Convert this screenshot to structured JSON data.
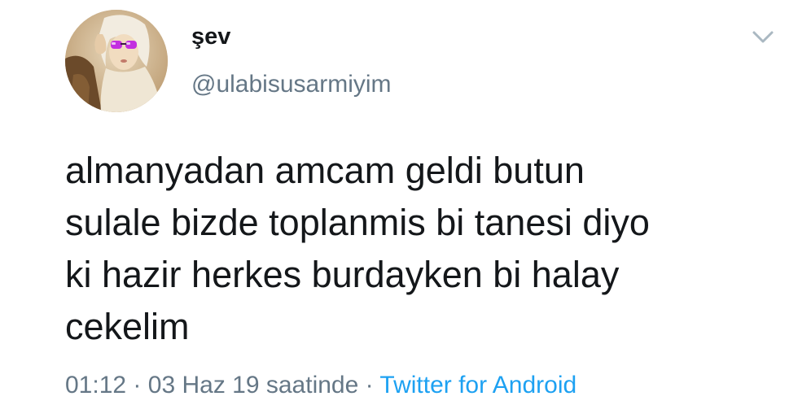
{
  "tweet": {
    "author": {
      "display_name": "şev",
      "handle": "@ulabisusarmiyim"
    },
    "text_lines": [
      "almanyadan amcam geldi butun",
      "sulale bizde toplanmis bi tanesi diyo",
      "ki hazir herkes burdayken bi halay",
      "cekelim"
    ],
    "time": "01:12",
    "separator": "·",
    "date": "03 Haz 19 saatinde",
    "source": "Twitter for Android",
    "icons": {
      "avatar": "profile-photo",
      "caret": "chevron-down-icon"
    },
    "colors": {
      "primary_text": "#14171a",
      "secondary_text": "#657786",
      "link": "#1da1f2",
      "caret": "#aab8c2"
    }
  }
}
